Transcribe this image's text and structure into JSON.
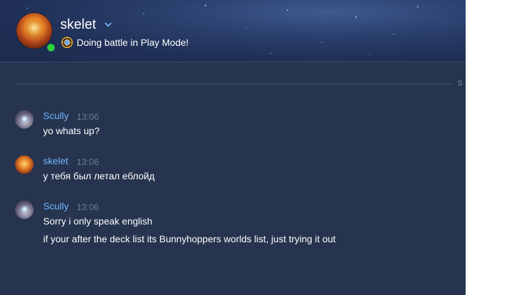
{
  "header": {
    "username": "skelet",
    "status_text": "Doing battle in Play Mode!",
    "online_color": "#29d03a",
    "chevron_icon": "chevron-down-icon",
    "game_icon": "hearthstone-icon"
  },
  "divider_label": "S",
  "messages": [
    {
      "author": "Scully",
      "time": "13:06",
      "lines": [
        "yo whats up?"
      ]
    },
    {
      "author": "skelet",
      "time": "13:06",
      "lines": [
        "у тебя был летал еблойд"
      ]
    },
    {
      "author": "Scully",
      "time": "13:06",
      "lines": [
        "Sorry i only speak english",
        "if your after the deck list its Bunnyhoppers worlds list, just trying it out"
      ]
    }
  ],
  "colors": {
    "chat_background": "#26344f",
    "author_name": "#6fb6ff",
    "timestamp": "#6e7a92",
    "message_text": "#ffffff"
  }
}
